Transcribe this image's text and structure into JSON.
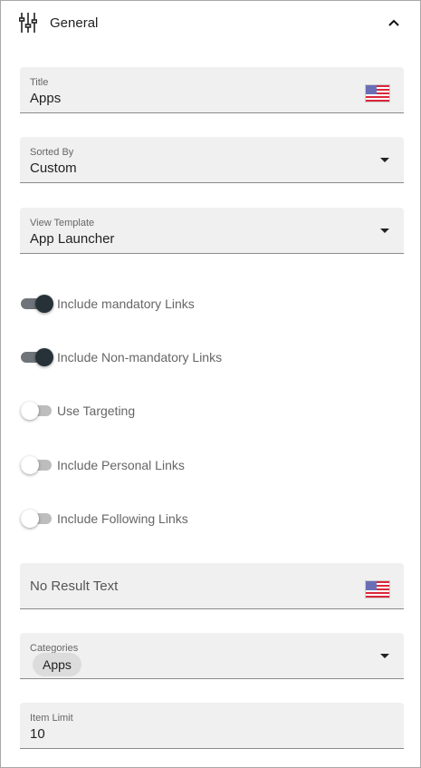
{
  "section": {
    "title": "General",
    "icon": "sliders-icon",
    "collapse_icon": "chevron-up-icon"
  },
  "fields": {
    "title": {
      "label": "Title",
      "value": "Apps"
    },
    "sorted_by": {
      "label": "Sorted By",
      "value": "Custom"
    },
    "view_template": {
      "label": "View Template",
      "value": "App Launcher"
    },
    "no_result_text": {
      "placeholder": "No Result Text"
    },
    "categories": {
      "label": "Categories",
      "chips": [
        "Apps"
      ]
    },
    "item_limit": {
      "label": "Item Limit",
      "value": "10"
    }
  },
  "toggles": [
    {
      "label": "Include mandatory Links",
      "on": true
    },
    {
      "label": "Include Non-mandatory Links",
      "on": true
    },
    {
      "label": "Use Targeting",
      "on": false
    },
    {
      "label": "Include Personal Links",
      "on": false
    },
    {
      "label": "Include Following Links",
      "on": false
    }
  ]
}
